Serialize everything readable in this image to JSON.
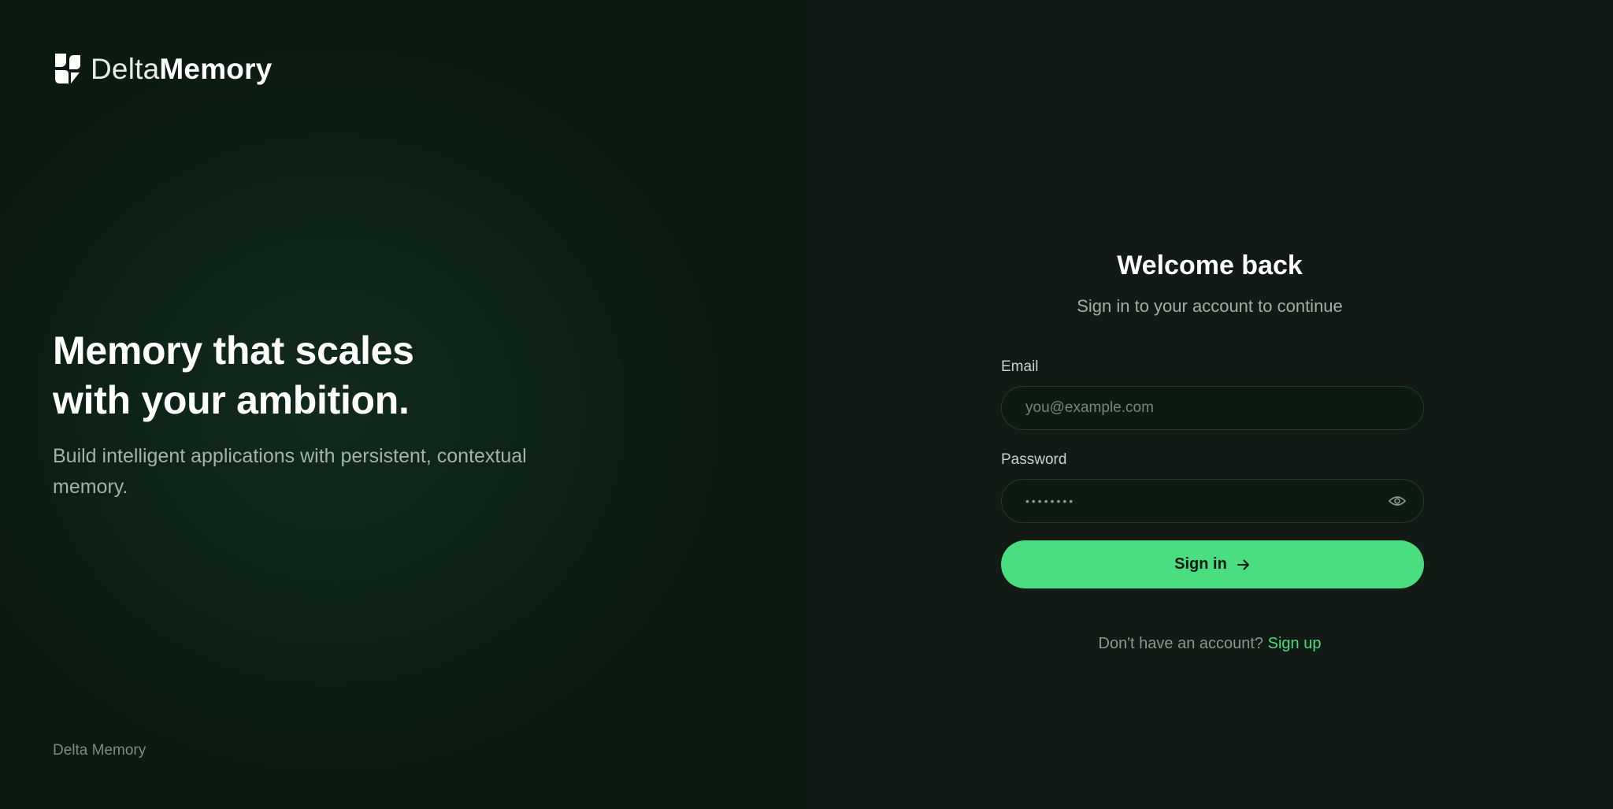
{
  "brand": {
    "name_light": "Delta",
    "name_bold": "Memory",
    "logo_icon": "delta-memory-logo-icon"
  },
  "hero": {
    "title_line1": "Memory that scales",
    "title_line2": "with your ambition.",
    "subtitle": "Build intelligent applications with persistent, contextual memory.",
    "footer": "Delta Memory"
  },
  "auth": {
    "title": "Welcome back",
    "subtitle": "Sign in to your account to continue",
    "email": {
      "label": "Email",
      "placeholder": "you@example.com",
      "value": ""
    },
    "password": {
      "label": "Password",
      "masked_value": "••••••••",
      "toggle_icon": "eye-icon"
    },
    "submit_label": "Sign in",
    "submit_icon": "arrow-right-icon",
    "signup_prompt": "Don't have an account?",
    "signup_link": "Sign up"
  },
  "colors": {
    "accent": "#4ade80",
    "background": "#111a14",
    "hero_background": "#0e2317"
  }
}
